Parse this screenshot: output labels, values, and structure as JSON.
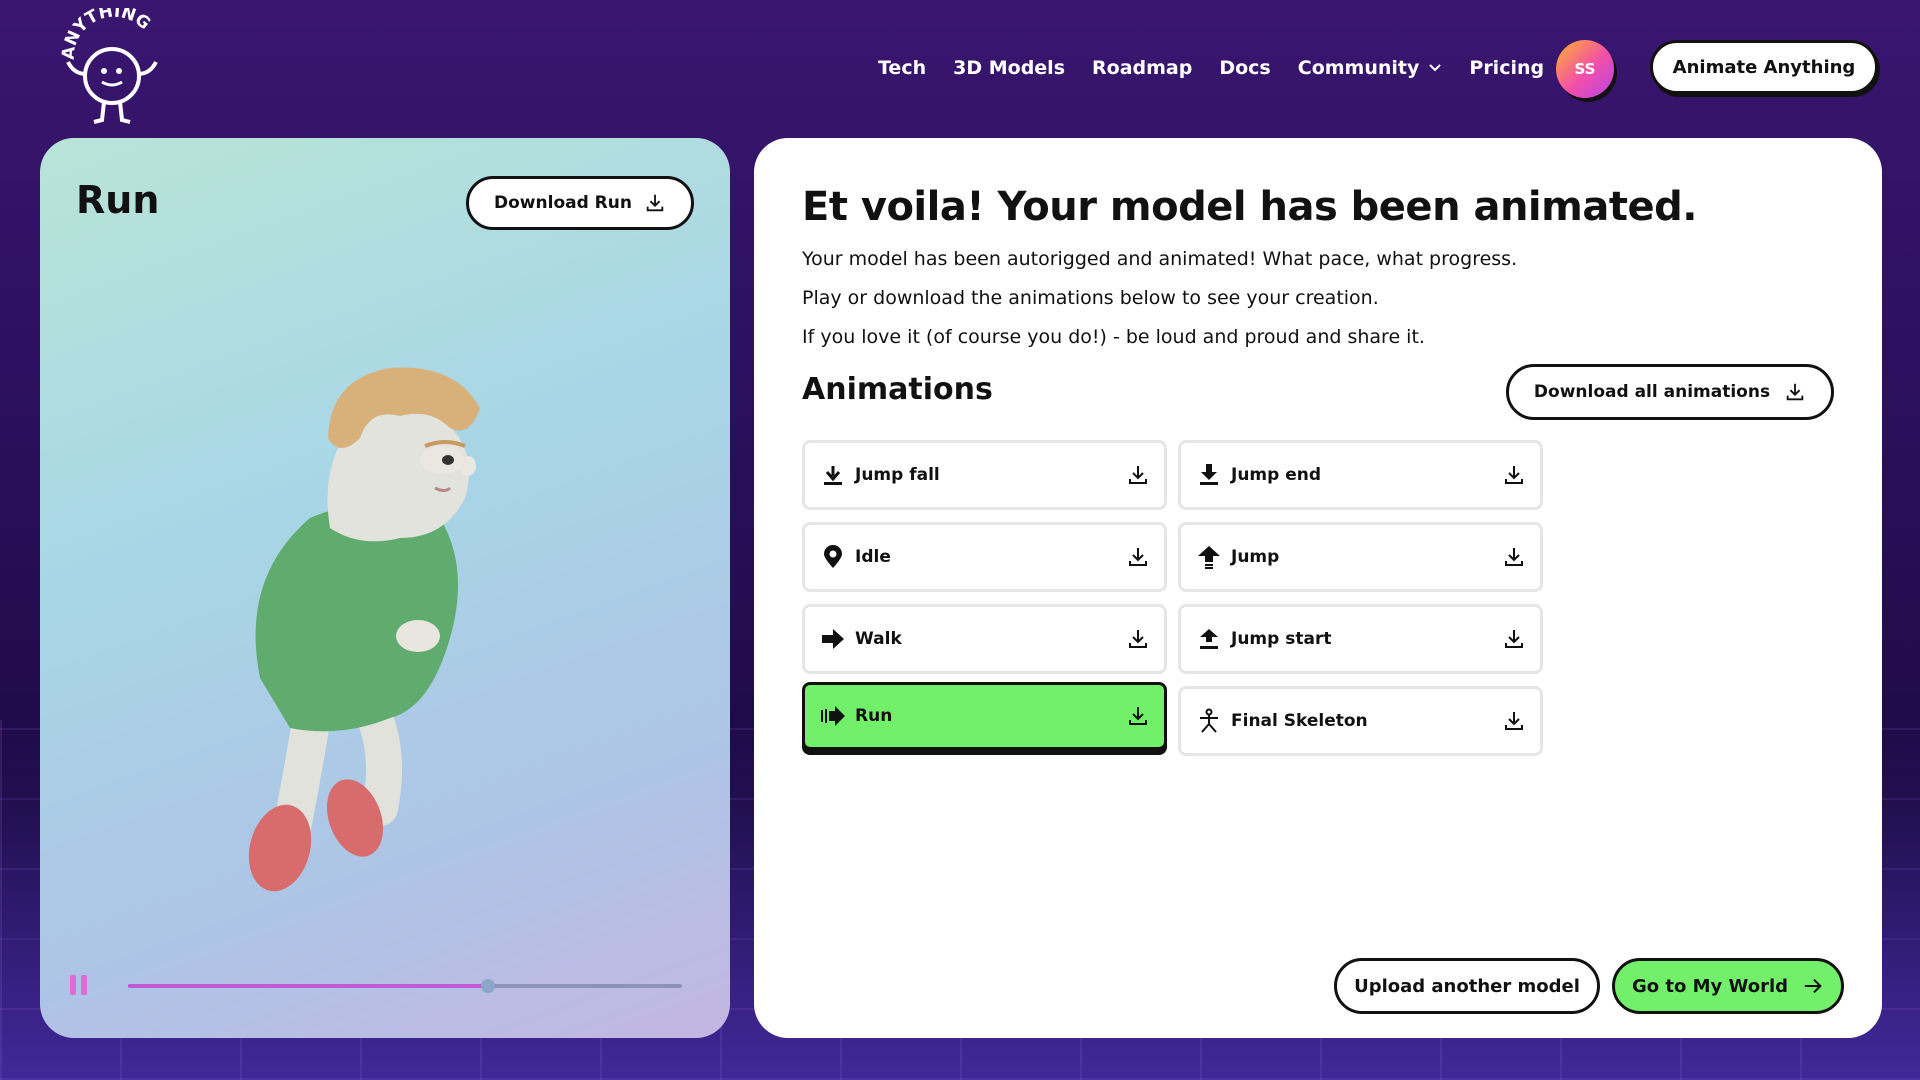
{
  "brand": {
    "name": "ANYTHING"
  },
  "nav": {
    "items": [
      "Tech",
      "3D Models",
      "Roadmap",
      "Docs",
      "Community",
      "Pricing"
    ],
    "avatar_initials": "SS",
    "cta_label": "Animate Anything"
  },
  "preview": {
    "title": "Run",
    "download_label": "Download Run",
    "progress": 0.65
  },
  "main": {
    "title": "Et voila! Your model has been animated.",
    "lines": [
      "Your model has been autorigged and animated! What pace, what progress.",
      "Play or download the animations below to see your creation.",
      "If you love it (of course you do!) - be loud and proud and share it."
    ],
    "animations_heading": "Animations",
    "download_all_label": "Download all animations",
    "animations": [
      {
        "label": "Jump fall",
        "icon": "jump-fall-icon"
      },
      {
        "label": "Jump end",
        "icon": "jump-end-icon"
      },
      {
        "label": "Idle",
        "icon": "location-pin-icon"
      },
      {
        "label": "Jump",
        "icon": "jump-icon"
      },
      {
        "label": "Walk",
        "icon": "arrow-right-icon"
      },
      {
        "label": "Jump start",
        "icon": "jump-start-icon"
      },
      {
        "label": "Run",
        "icon": "run-icon",
        "active": true
      },
      {
        "label": "Final Skeleton",
        "icon": "skeleton-icon"
      }
    ],
    "upload_label": "Upload another model",
    "world_label": "Go to My World"
  },
  "colors": {
    "accent_green": "#72f06a",
    "background_purple": "#2a0f5c",
    "progress": "#c05bd6"
  }
}
